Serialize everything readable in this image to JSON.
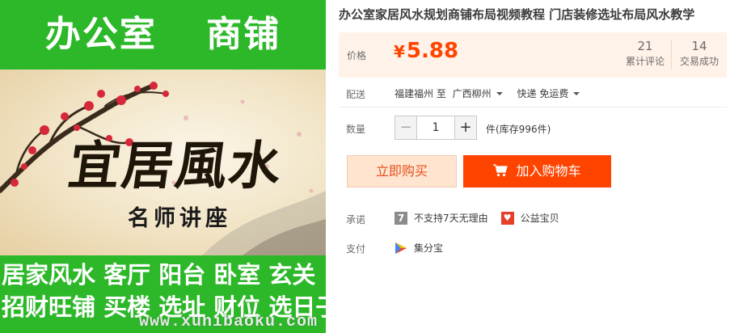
{
  "image": {
    "top_banner": [
      "办公室",
      "商铺"
    ],
    "calligraphy": "宜居風水",
    "lecture": "名师讲座",
    "bottom_line1": "居家风水 客厅 阳台 卧室 玄关",
    "bottom_line2": "招财旺铺 买楼 选址 财位 选日子",
    "watermark": "www.xunibaoku.com"
  },
  "product": {
    "title": "办公室家居风水规划商铺布局视频教程 门店装修选址布局风水教学",
    "price_label": "价格",
    "currency": "¥",
    "price": "5.88",
    "reviews_count": "21",
    "reviews_label": "累计评论",
    "deals_count": "14",
    "deals_label": "交易成功"
  },
  "delivery": {
    "label": "配送",
    "from": "福建福州 至",
    "to": "广西柳州",
    "shipping": "快递 免运费"
  },
  "quantity": {
    "label": "数量",
    "minus": "−",
    "value": "1",
    "plus": "+",
    "stock": "件(库存996件)"
  },
  "actions": {
    "buy_now": "立即购买",
    "add_to_cart": "加入购物车"
  },
  "promise": {
    "label": "承诺",
    "item1_icon": "7",
    "item1": "不支持7天无理由",
    "item2": "公益宝贝"
  },
  "payment": {
    "label": "支付",
    "method": "集分宝"
  },
  "colors": {
    "accent": "#ff4400",
    "banner_green": "#2db82a",
    "price_bg": "#fff2e8"
  }
}
